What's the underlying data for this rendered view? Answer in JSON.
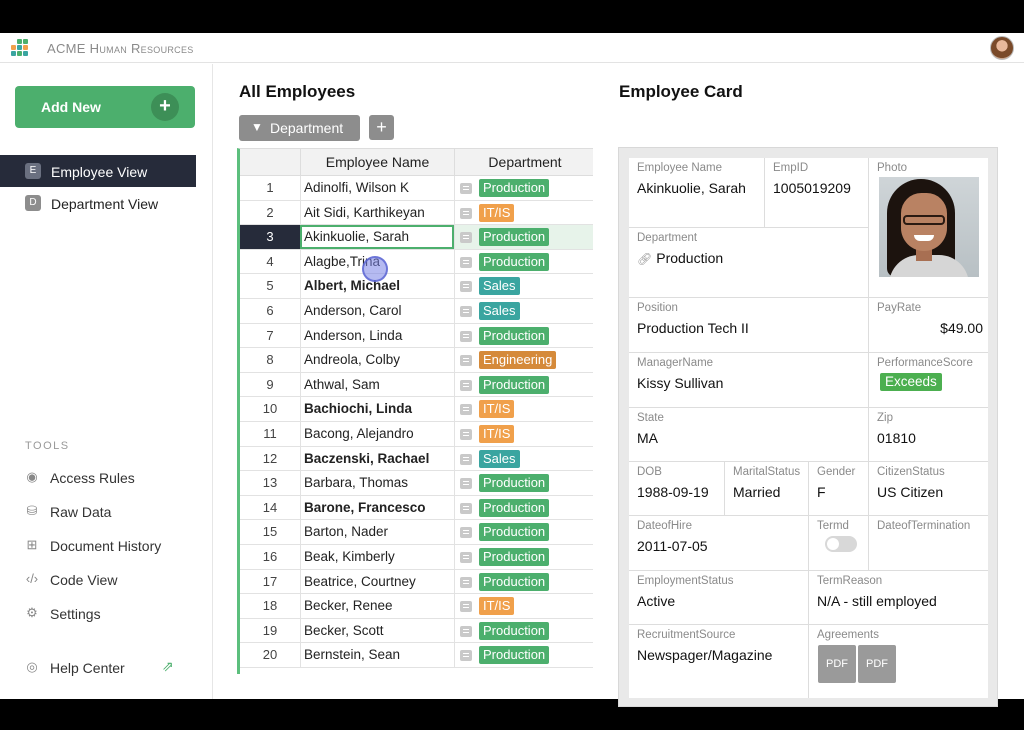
{
  "app": {
    "title": "ACME Human Resources"
  },
  "sidebar": {
    "add_new": "Add New",
    "add_icon": "+",
    "views": [
      {
        "badge": "E",
        "label": "Employee View"
      },
      {
        "badge": "D",
        "label": "Department View"
      }
    ],
    "tools_heading": "TOOLS",
    "tools": [
      {
        "label": "Access Rules",
        "icon": "eye-icon"
      },
      {
        "label": "Raw Data",
        "icon": "database-icon"
      },
      {
        "label": "Document History",
        "icon": "history-icon"
      },
      {
        "label": "Code View",
        "icon": "code-icon"
      },
      {
        "label": "Settings",
        "icon": "gear-icon"
      }
    ],
    "help": "Help Center"
  },
  "employees": {
    "title": "All Employees",
    "filter_label": "Department",
    "columns": {
      "name": "Employee Name",
      "department": "Department"
    },
    "rows": [
      {
        "n": "1",
        "name": "Adinolfi, Wilson  K",
        "bold": false,
        "dept": "Production"
      },
      {
        "n": "2",
        "name": "Ait Sidi, Karthikeyan",
        "bold": false,
        "dept": "IT/IS"
      },
      {
        "n": "3",
        "name": "Akinkuolie, Sarah",
        "bold": false,
        "dept": "Production"
      },
      {
        "n": "4",
        "name": "Alagbe,Trina",
        "bold": false,
        "dept": "Production"
      },
      {
        "n": "5",
        "name": "Albert, Michael",
        "bold": true,
        "dept": "Sales"
      },
      {
        "n": "6",
        "name": "Anderson, Carol",
        "bold": false,
        "dept": "Sales"
      },
      {
        "n": "7",
        "name": "Anderson, Linda",
        "bold": false,
        "dept": "Production"
      },
      {
        "n": "8",
        "name": "Andreola, Colby",
        "bold": false,
        "dept": "Engineering"
      },
      {
        "n": "9",
        "name": "Athwal, Sam",
        "bold": false,
        "dept": "Production"
      },
      {
        "n": "10",
        "name": "Bachiochi, Linda",
        "bold": true,
        "dept": "IT/IS"
      },
      {
        "n": "11",
        "name": "Bacong, Alejandro",
        "bold": false,
        "dept": "IT/IS"
      },
      {
        "n": "12",
        "name": "Baczenski, Rachael",
        "bold": true,
        "dept": "Sales"
      },
      {
        "n": "13",
        "name": "Barbara, Thomas",
        "bold": false,
        "dept": "Production"
      },
      {
        "n": "14",
        "name": "Barone, Francesco",
        "bold": true,
        "dept": "Production"
      },
      {
        "n": "15",
        "name": "Barton, Nader",
        "bold": false,
        "dept": "Production"
      },
      {
        "n": "16",
        "name": "Beak, Kimberly",
        "bold": false,
        "dept": "Production"
      },
      {
        "n": "17",
        "name": "Beatrice, Courtney",
        "bold": false,
        "dept": "Production"
      },
      {
        "n": "18",
        "name": "Becker, Renee",
        "bold": false,
        "dept": "IT/IS"
      },
      {
        "n": "19",
        "name": "Becker, Scott",
        "bold": false,
        "dept": "Production"
      },
      {
        "n": "20",
        "name": "Bernstein, Sean",
        "bold": false,
        "dept": "Production"
      }
    ],
    "selected_row": 3,
    "dept_colors": {
      "Production": "#4caf6d",
      "IT/IS": "#f0a04b",
      "Sales": "#3aa5a0",
      "Engineering": "#d58a3a"
    }
  },
  "card": {
    "title": "Employee Card",
    "employee_name": {
      "label": "Employee Name",
      "value": "Akinkuolie, Sarah"
    },
    "emp_id": {
      "label": "EmpID",
      "value": "1005019209"
    },
    "photo": {
      "label": "Photo"
    },
    "department": {
      "label": "Department",
      "value": "Production"
    },
    "position": {
      "label": "Position",
      "value": "Production Tech II"
    },
    "pay_rate": {
      "label": "PayRate",
      "value": "$49.00"
    },
    "manager": {
      "label": "ManagerName",
      "value": "Kissy Sullivan"
    },
    "performance": {
      "label": "PerformanceScore",
      "value": "Exceeds"
    },
    "state": {
      "label": "State",
      "value": "MA"
    },
    "zip": {
      "label": "Zip",
      "value": "01810"
    },
    "dob": {
      "label": "DOB",
      "value": "1988-09-19"
    },
    "marital": {
      "label": "MaritalStatus",
      "value": "Married"
    },
    "gender": {
      "label": "Gender",
      "value": "F"
    },
    "citizen": {
      "label": "CitizenStatus",
      "value": "US Citizen"
    },
    "hire": {
      "label": "DateofHire",
      "value": "2011-07-05"
    },
    "termd": {
      "label": "Termd"
    },
    "termination": {
      "label": "DateofTermination"
    },
    "employment_status": {
      "label": "EmploymentStatus",
      "value": "Active"
    },
    "term_reason": {
      "label": "TermReason",
      "value": "N/A - still employed"
    },
    "recruitment": {
      "label": "RecruitmentSource",
      "value": "Newspager/Magazine"
    },
    "agreements": {
      "label": "Agreements",
      "files": [
        "PDF",
        "PDF"
      ]
    }
  }
}
